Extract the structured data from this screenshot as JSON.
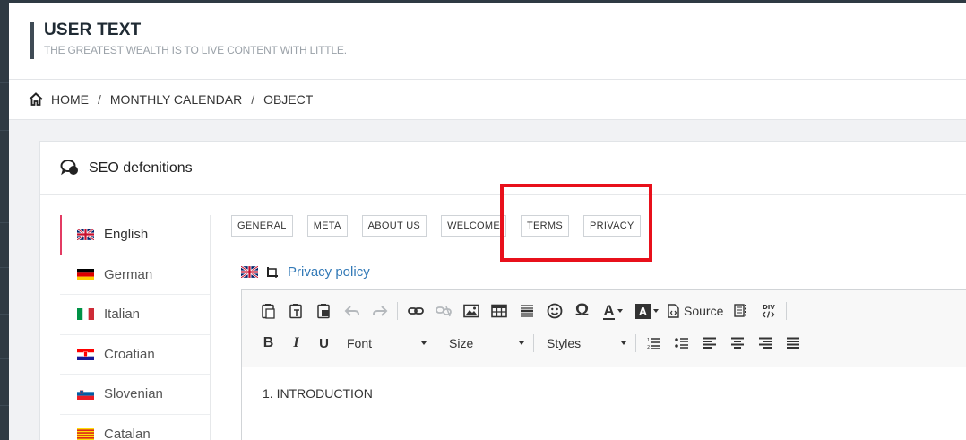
{
  "header": {
    "title": "USER TEXT",
    "subtitle": "THE GREATEST WEALTH IS TO LIVE CONTENT WITH LITTLE."
  },
  "breadcrumb": {
    "items": [
      "HOME",
      "MONTHLY CALENDAR",
      "OBJECT"
    ],
    "separator": "/"
  },
  "panel": {
    "title": "SEO defenitions"
  },
  "languages": [
    {
      "label": "English",
      "flag": "uk-flag-icon",
      "active": true
    },
    {
      "label": "German",
      "flag": "germany-flag-icon",
      "active": false
    },
    {
      "label": "Italian",
      "flag": "italy-flag-icon",
      "active": false
    },
    {
      "label": "Croatian",
      "flag": "croatia-flag-icon",
      "active": false
    },
    {
      "label": "Slovenian",
      "flag": "slovenia-flag-icon",
      "active": false
    },
    {
      "label": "Catalan",
      "flag": "catalonia-flag-icon",
      "active": false
    }
  ],
  "tabs": [
    "GENERAL",
    "META",
    "ABOUT US",
    "WELCOME",
    "TERMS",
    "PRIVACY"
  ],
  "editor": {
    "title": "Privacy policy",
    "source_label": "Source",
    "font_label": "Font",
    "size_label": "Size",
    "styles_label": "Styles",
    "bold_label": "B",
    "italic_label": "I",
    "underline_label": "U",
    "omega_label": "Ω",
    "text_color_label": "A",
    "bg_color_label": "A",
    "content": "1. INTRODUCTION"
  },
  "colors": {
    "accent_active": "#e33b63",
    "link": "#337ab7",
    "highlight": "#e8101b",
    "sidebar": "#2f3a43"
  }
}
